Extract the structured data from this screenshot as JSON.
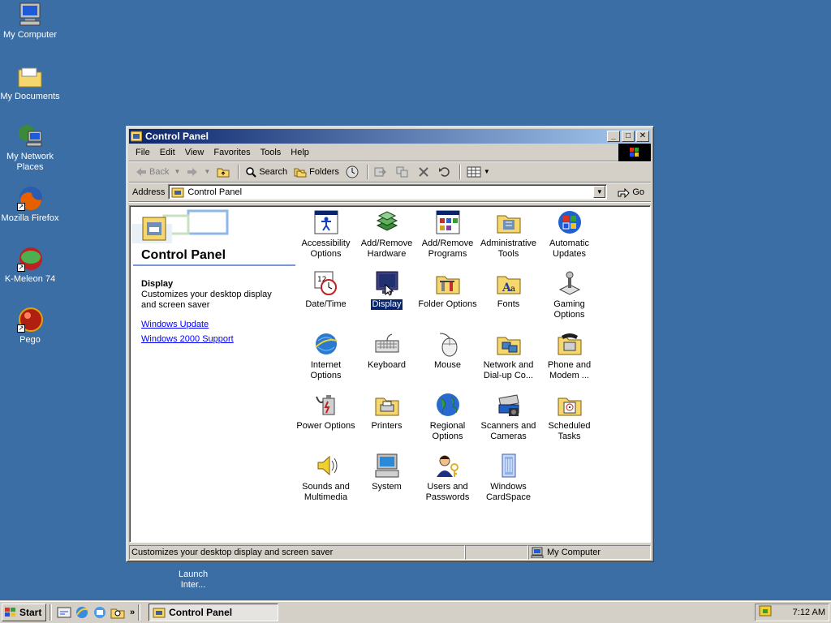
{
  "desktop": {
    "icons": [
      {
        "label": "My Computer",
        "icon": "computer-icon"
      },
      {
        "label": "My Documents",
        "icon": "folder-icon"
      },
      {
        "label": "My Network Places",
        "icon": "network-icon"
      },
      {
        "label": "Mozilla Firefox",
        "icon": "firefox-icon"
      },
      {
        "label": "K-Meleon 74",
        "icon": "kmeleon-icon"
      },
      {
        "label": "Pego",
        "icon": "pego-icon"
      }
    ],
    "hidden_icon_label": "Launch Inter..."
  },
  "window": {
    "title": "Control Panel",
    "menu": [
      "File",
      "Edit",
      "View",
      "Favorites",
      "Tools",
      "Help"
    ],
    "toolbar": {
      "back": "Back",
      "search": "Search",
      "folders": "Folders"
    },
    "address": {
      "label": "Address",
      "value": "Control Panel",
      "go": "Go"
    },
    "left_pane": {
      "title": "Control Panel",
      "selected_title": "Display",
      "selected_desc": "Customizes your desktop display and screen saver",
      "links": [
        "Windows Update",
        "Windows 2000 Support"
      ]
    },
    "items": [
      {
        "label": "Accessibility Options",
        "icon": "accessibility-icon"
      },
      {
        "label": "Add/Remove Hardware",
        "icon": "hardware-icon"
      },
      {
        "label": "Add/Remove Programs",
        "icon": "programs-icon"
      },
      {
        "label": "Administrative Tools",
        "icon": "admin-tools-icon"
      },
      {
        "label": "Automatic Updates",
        "icon": "windows-update-icon"
      },
      {
        "label": "Date/Time",
        "icon": "clock-icon"
      },
      {
        "label": "Display",
        "icon": "display-icon",
        "selected": true
      },
      {
        "label": "Folder Options",
        "icon": "folder-options-icon"
      },
      {
        "label": "Fonts",
        "icon": "fonts-icon"
      },
      {
        "label": "Gaming Options",
        "icon": "joystick-icon"
      },
      {
        "label": "Internet Options",
        "icon": "internet-icon"
      },
      {
        "label": "Keyboard",
        "icon": "keyboard-icon"
      },
      {
        "label": "Mouse",
        "icon": "mouse-icon"
      },
      {
        "label": "Network and Dial-up Co...",
        "icon": "network-dialup-icon"
      },
      {
        "label": "Phone and Modem ...",
        "icon": "phone-icon"
      },
      {
        "label": "Power Options",
        "icon": "power-icon"
      },
      {
        "label": "Printers",
        "icon": "printer-icon"
      },
      {
        "label": "Regional Options",
        "icon": "globe-icon"
      },
      {
        "label": "Scanners and Cameras",
        "icon": "scanner-icon"
      },
      {
        "label": "Scheduled Tasks",
        "icon": "scheduled-tasks-icon"
      },
      {
        "label": "Sounds and Multimedia",
        "icon": "speaker-icon"
      },
      {
        "label": "System",
        "icon": "system-icon"
      },
      {
        "label": "Users and Passwords",
        "icon": "users-icon"
      },
      {
        "label": "Windows CardSpace",
        "icon": "cardspace-icon"
      }
    ],
    "status": {
      "text": "Customizes your desktop display and screen saver",
      "zone": "My Computer"
    }
  },
  "taskbar": {
    "start": "Start",
    "task": "Control Panel",
    "clock": "7:12 AM"
  }
}
